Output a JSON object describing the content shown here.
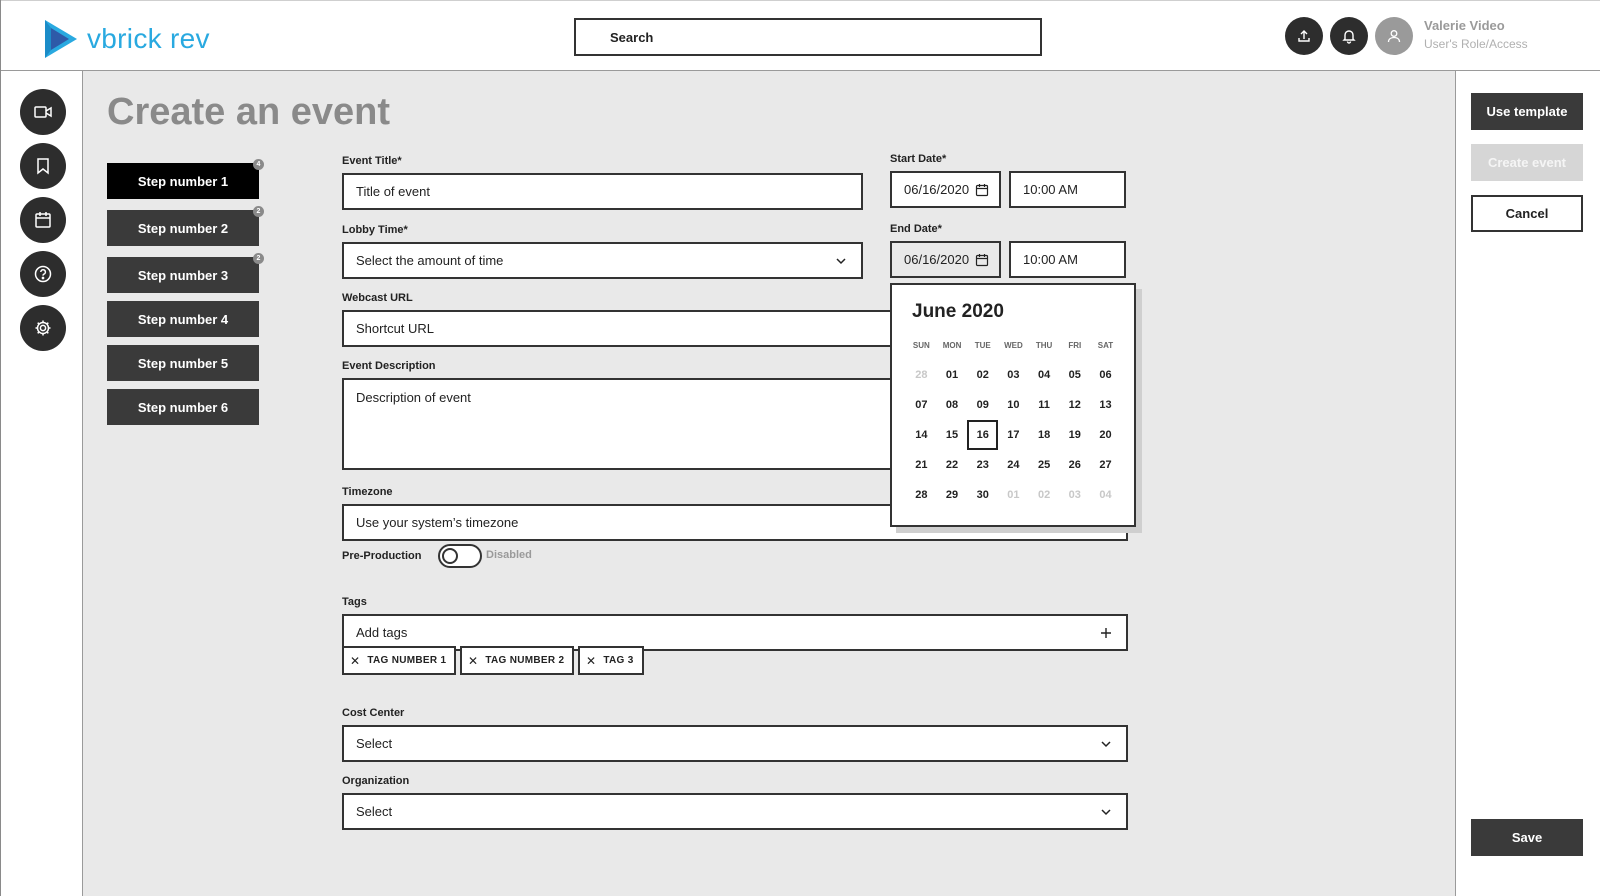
{
  "header": {
    "app_name": "vbrick rev",
    "search_placeholder": "Search",
    "user_name": "Valerie Video",
    "user_role": "User's Role/Access"
  },
  "page_title": "Create an event",
  "steps": [
    {
      "label": "Step number 1",
      "badge": "4",
      "active": true
    },
    {
      "label": "Step number 2",
      "badge": "2",
      "active": false
    },
    {
      "label": "Step number 3",
      "badge": "2",
      "active": false
    },
    {
      "label": "Step number 4",
      "badge": "",
      "active": false
    },
    {
      "label": "Step number 5",
      "badge": "",
      "active": false
    },
    {
      "label": "Step number 6",
      "badge": "",
      "active": false
    }
  ],
  "form": {
    "event_title": {
      "label": "Event Title*",
      "value": "Title of event"
    },
    "lobby_time": {
      "label": "Lobby Time*",
      "value": "Select the amount of time"
    },
    "webcast_url": {
      "label": "Webcast URL",
      "value": "Shortcut URL"
    },
    "description": {
      "label": "Event Description",
      "value": "Description of event"
    },
    "timezone": {
      "label": "Timezone",
      "value": "Use your system’s timezone"
    },
    "start_date": {
      "label": "Start Date*",
      "date": "06/16/2020",
      "time": "10:00 AM"
    },
    "end_date": {
      "label": "End Date*",
      "date": "06/16/2020",
      "time": "10:00 AM"
    },
    "pre_production": {
      "label": "Pre-Production",
      "status": "Disabled"
    },
    "tags": {
      "label": "Tags",
      "placeholder": "Add tags",
      "items": [
        "TAG NUMBER 1",
        "TAG NUMBER 2",
        "TAG 3"
      ]
    },
    "cost_center": {
      "label": "Cost Center",
      "value": "Select"
    },
    "organization": {
      "label": "Organization",
      "value": "Select"
    }
  },
  "calendar": {
    "title": "June 2020",
    "weekdays": [
      "SUN",
      "MON",
      "TUE",
      "WED",
      "THU",
      "FRI",
      "SAT"
    ],
    "weeks": [
      [
        "28",
        "01",
        "02",
        "03",
        "04",
        "05",
        "06"
      ],
      [
        "07",
        "08",
        "09",
        "10",
        "11",
        "12",
        "13"
      ],
      [
        "14",
        "15",
        "16",
        "17",
        "18",
        "19",
        "20"
      ],
      [
        "21",
        "22",
        "23",
        "24",
        "25",
        "26",
        "27"
      ],
      [
        "28",
        "29",
        "30",
        "01",
        "02",
        "03",
        "04"
      ]
    ],
    "selected": "16"
  },
  "actions": {
    "use_template": "Use template",
    "create_event": "Create event",
    "cancel": "Cancel",
    "save": "Save"
  },
  "colors": {
    "brand": "#29a9e0",
    "dark": "#2d2d2d",
    "background": "#e9e9e9"
  }
}
